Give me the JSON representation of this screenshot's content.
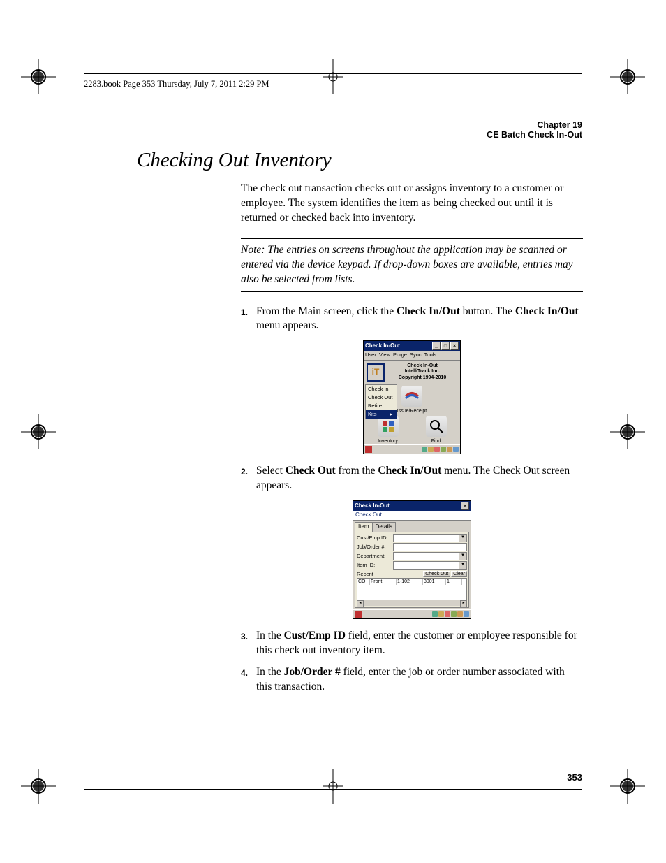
{
  "header": "2283.book  Page 353  Thursday, July 7, 2011  2:29 PM",
  "chapter": {
    "num": "Chapter 19",
    "title": "CE Batch Check In-Out"
  },
  "page_title": "Checking Out Inventory",
  "intro": "The check out transaction checks out or assigns inventory to a customer or employee. The system identifies the item as being checked out until it is returned or checked back into inventory.",
  "note": "Note:   The entries on screens throughout the application may be scanned or entered via the device keypad. If drop-down boxes are available, entries may also be selected from lists.",
  "steps": {
    "s1": {
      "n": "1.",
      "pre": "From the Main screen, click the ",
      "b1": "Check In/Out",
      "mid": " button. The ",
      "b2": "Check In/Out",
      "post": " menu appears."
    },
    "s2": {
      "n": "2.",
      "pre": "Select ",
      "b1": "Check Out",
      "mid": " from the ",
      "b2": "Check In/Out",
      "post": " menu. The Check Out screen appears."
    },
    "s3": {
      "n": "3.",
      "pre": "In the ",
      "b1": "Cust/Emp ID",
      "post": " field, enter the customer or employee responsible for this check out inventory item."
    },
    "s4": {
      "n": "4.",
      "pre": "In the ",
      "b1": "Job/Order #",
      "post": " field, enter the job or order number associated with this transaction."
    }
  },
  "app1": {
    "title": "Check In-Out",
    "menus": [
      "User",
      "View",
      "Purge",
      "Sync",
      "Tools"
    ],
    "brand": {
      "l1": "Check In-Out",
      "l2": "IntelliTrack Inc.",
      "l3": "Copyright 1994-2010"
    },
    "popup": [
      "Check In",
      "Check Out",
      "Retire",
      "Kits"
    ],
    "cells": {
      "c1": "Issue/Receipt",
      "c2": "Inventory",
      "c3": "Find"
    }
  },
  "app2": {
    "title": "Check In-Out",
    "sub": "Check Out",
    "tabs": [
      "Item",
      "Details"
    ],
    "labels": {
      "cust": "Cust/Emp ID:",
      "job": "Job/Order #:",
      "dept": "Department:",
      "item": "Item ID:"
    },
    "btns": {
      "recent": "Recent",
      "checkout": "Check Out",
      "clear": "Clear"
    },
    "grid": {
      "row": [
        "CO",
        "Front",
        "1-102",
        "3001",
        "1"
      ]
    }
  },
  "page_num": "353"
}
